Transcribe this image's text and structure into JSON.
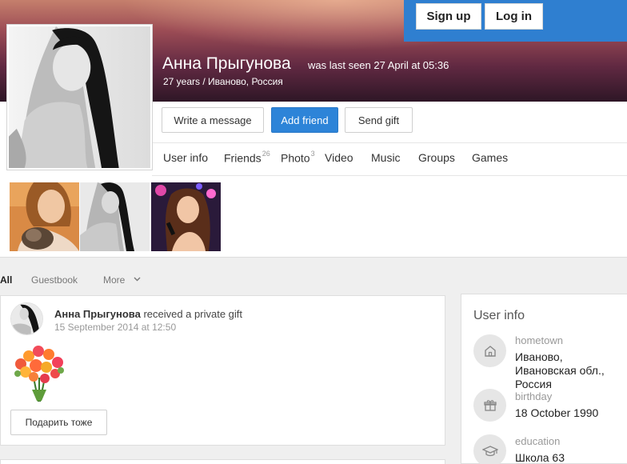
{
  "auth": {
    "signup_label": "Sign up",
    "login_label": "Log in"
  },
  "profile": {
    "name": "Анна Прыгунова",
    "last_seen": "was last seen 27 April at 05:36",
    "age_location": "27 years / Иваново, Россия"
  },
  "actions": {
    "write_message": "Write a message",
    "add_friend": "Add friend",
    "send_gift": "Send gift"
  },
  "nav": {
    "user_info": "User info",
    "friends": "Friends",
    "friends_count": "26",
    "photo": "Photo",
    "photo_count": "3",
    "video": "Video",
    "music": "Music",
    "groups": "Groups",
    "games": "Games"
  },
  "feed_tabs": {
    "all": "All",
    "guestbook": "Guestbook",
    "more": "More"
  },
  "post": {
    "author": "Анна Прыгунова",
    "action": "received a private gift",
    "date": "15 September 2014 at 12:50",
    "gift_button": "Подарить тоже"
  },
  "user_info": {
    "title": "User info",
    "hometown_label": "hometown",
    "hometown_value": "Иваново, Ивановская обл., Россия",
    "birthday_label": "birthday",
    "birthday_value": "18 October 1990",
    "education_label": "education",
    "education_value": "Школа 63"
  },
  "colors": {
    "accent": "#2d84d8",
    "auth_bar": "#2f7fd0",
    "page_bg": "#efefef"
  },
  "icons": {
    "hometown": "house-icon",
    "birthday": "gift-icon",
    "education": "graduation-cap-icon",
    "more": "chevron-down-icon"
  }
}
